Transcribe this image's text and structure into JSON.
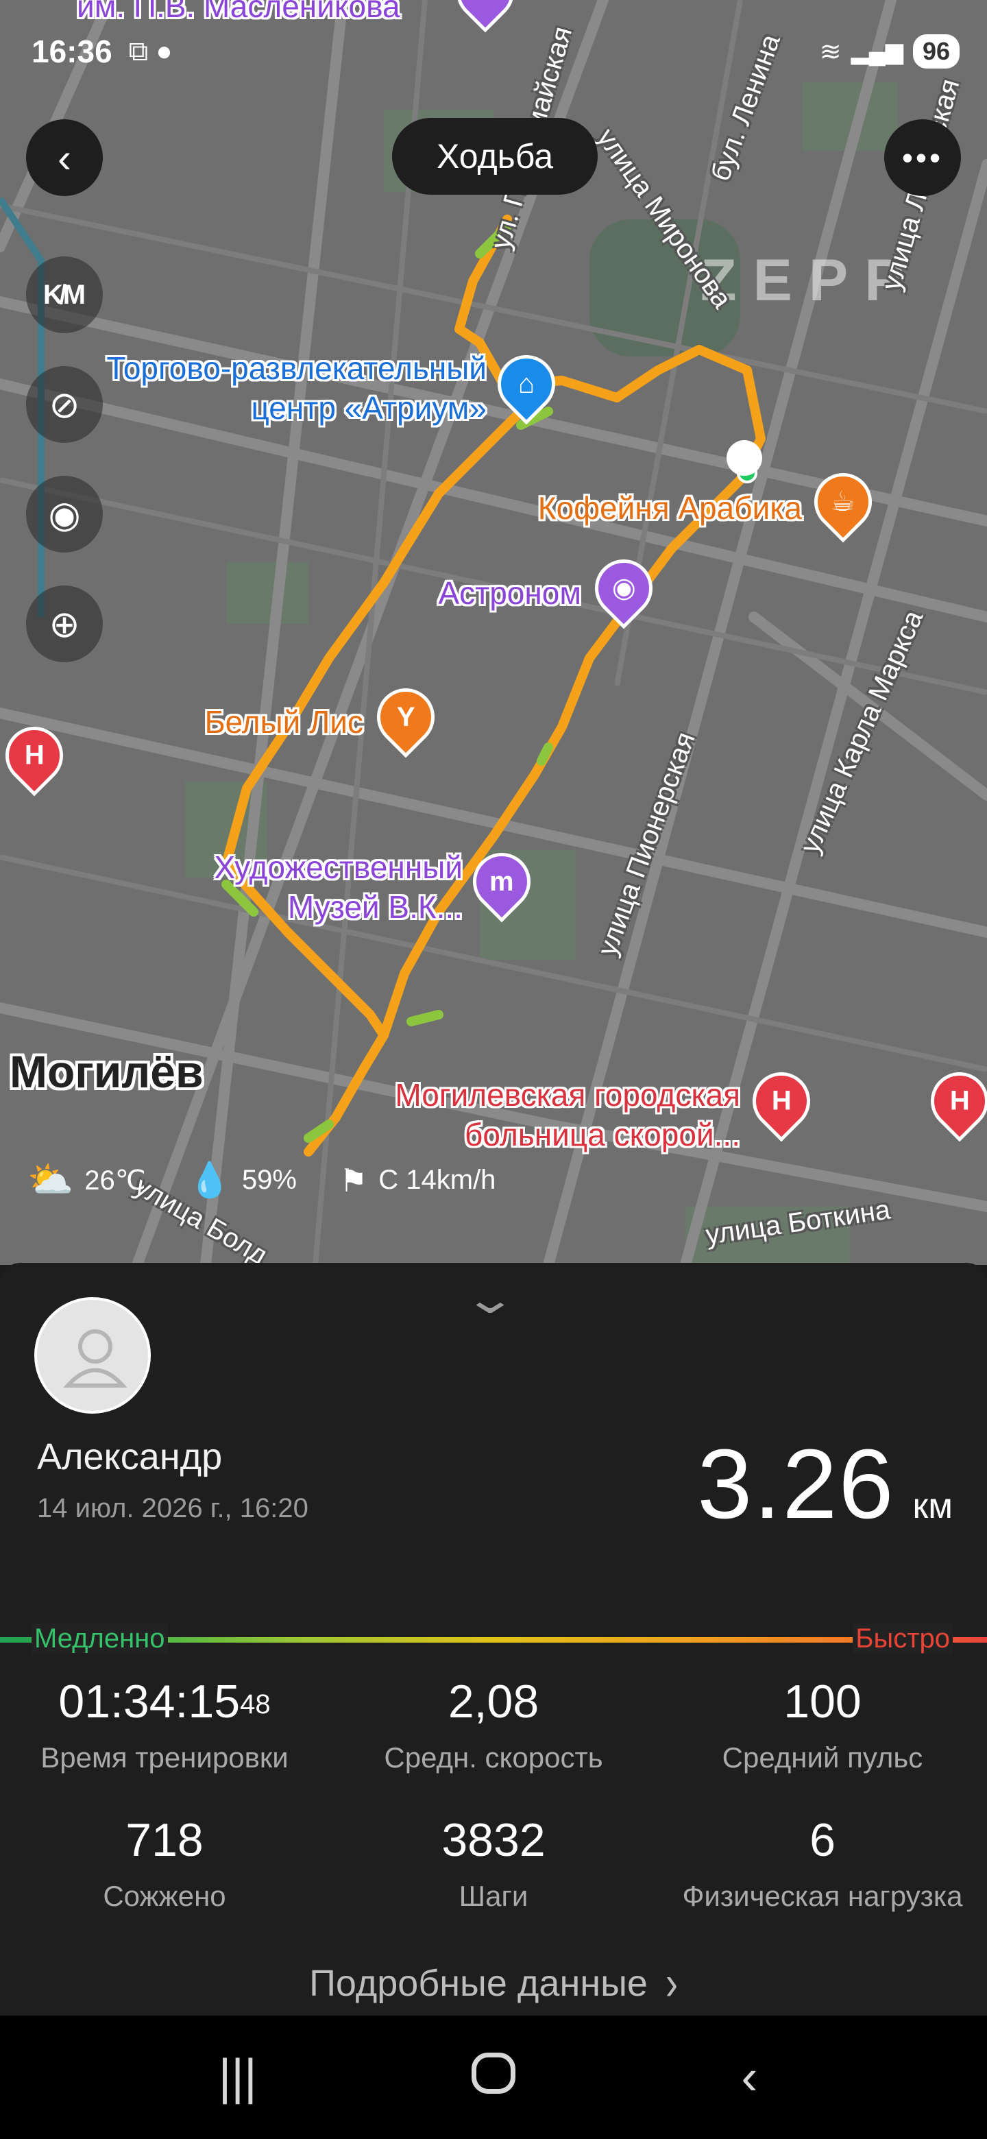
{
  "status_bar": {
    "time": "16:36",
    "signal": "5",
    "battery": "96"
  },
  "header": {
    "title": "Ходьба"
  },
  "map": {
    "watermark": "ZEPP",
    "city": "Могилёв",
    "pois": {
      "atrium": "Торгово-развлекательный\nцентр «Атриум»",
      "arabika": "Кофейня Арабика",
      "astronom": "Астроном",
      "belyi_lis": "Белый Лис",
      "museum": "Художественный\nМузей В.К...",
      "hospital": "Могилевская городская\nбольница скорой...",
      "top_label": "им. П.В. Масленикова"
    },
    "streets": {
      "pervomaiskaya": "ул. Первомайская",
      "mironova": "улица Миронова",
      "lenina": "бул. Ленина",
      "leninskaya": "улица Ленинская",
      "pionerskaya": "улица Пионерская",
      "karla_marksa": "улица Карла Маркса",
      "botkina": "улица Боткина",
      "bolshaya": "улица Болд"
    }
  },
  "weather": {
    "temperature": "26℃",
    "humidity": "59%",
    "wind": "С 14km/h"
  },
  "workout": {
    "user_name": "Александр",
    "date": "14 июл. 2026 г., 16:20",
    "distance": "3.26",
    "distance_unit": "км",
    "pace_slow": "Медленно",
    "pace_fast": "Быстро",
    "stats": [
      {
        "value": "01:34:15",
        "sup": "48",
        "label": "Время тренировки"
      },
      {
        "value": "2,08",
        "label": "Средн. скорость"
      },
      {
        "value": "100",
        "label": "Средний пульс"
      },
      {
        "value": "718",
        "label": "Сожжено"
      },
      {
        "value": "3832",
        "label": "Шаги"
      },
      {
        "value": "6",
        "label": "Физическая нагрузка"
      }
    ],
    "details_label": "Подробные данные"
  }
}
